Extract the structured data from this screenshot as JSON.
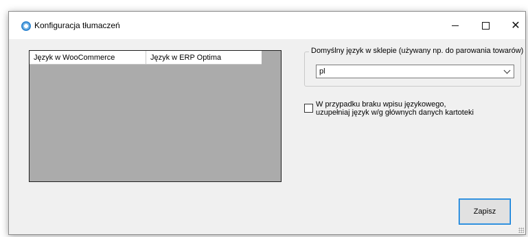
{
  "window": {
    "title": "Konfiguracja tłumaczeń",
    "controls": {
      "minimize_icon": "minimize-icon",
      "maximize_icon": "maximize-icon",
      "close_icon": "close-icon",
      "close_glyph": "✕"
    }
  },
  "grid": {
    "columns": [
      "Język w WooCommerce",
      "Język w ERP Optima"
    ]
  },
  "default_language": {
    "group_label": "Domyślny język w sklepie (używany np. do parowania towarów)",
    "selected_value": "pl"
  },
  "fallback_option": {
    "label_line1": "W przypadku braku wpisu językowego,",
    "label_line2": "uzupełniaj język w/g głównych danych kartoteki",
    "checked": false
  },
  "actions": {
    "save_label": "Zapisz"
  },
  "colors": {
    "accent": "#0078d7",
    "grid_background": "#ababab",
    "window_background": "#f0f0f0"
  }
}
